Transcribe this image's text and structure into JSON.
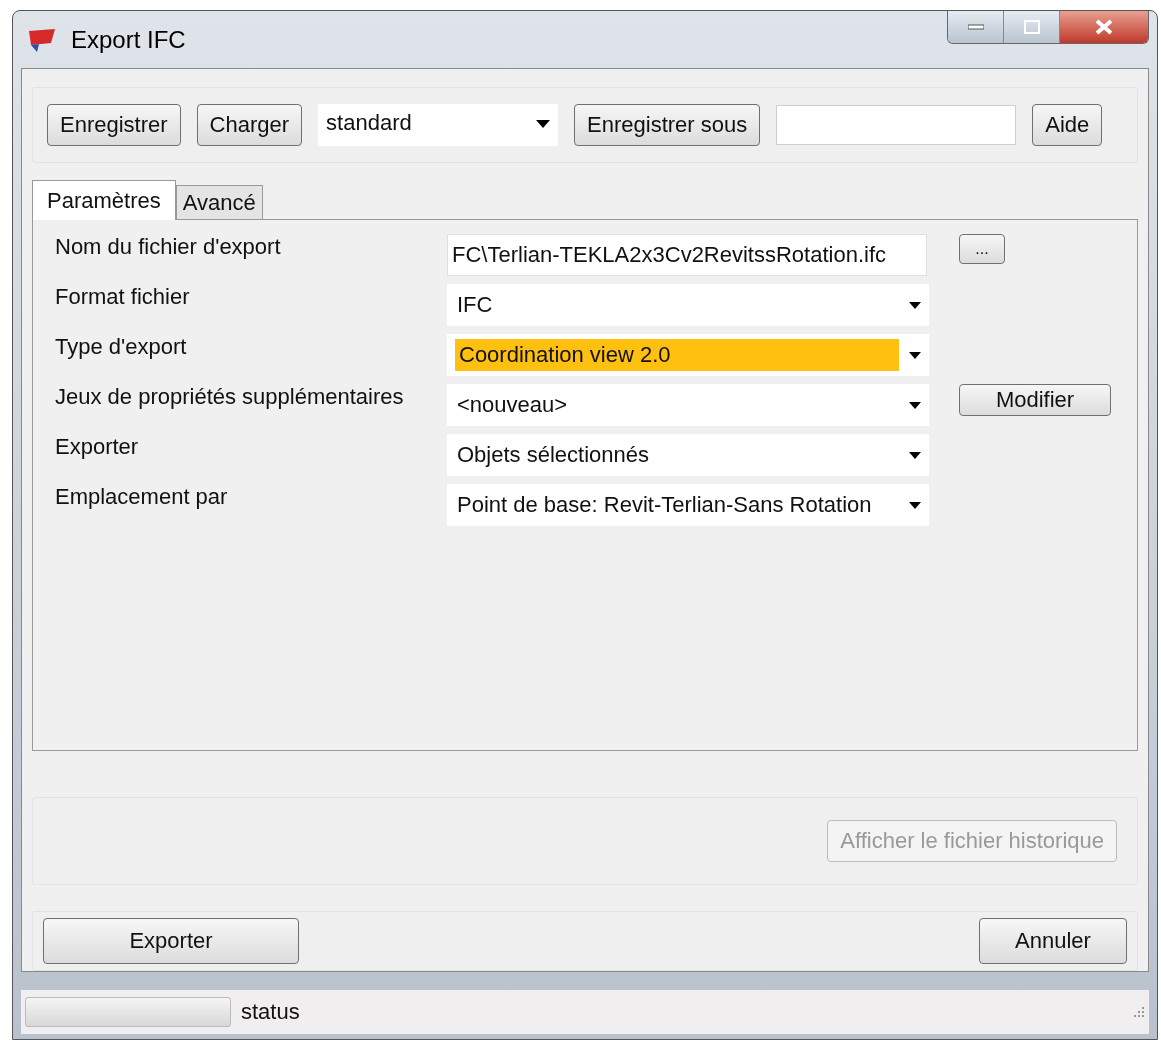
{
  "window": {
    "title": "Export IFC"
  },
  "toolbar": {
    "buttons": [
      "Enregistrer",
      "Charger"
    ],
    "config_select": "standard",
    "save_as_button": "Enregistrer sous",
    "help_button": "Aide"
  },
  "tabs": [
    {
      "label": "Paramètres",
      "selected": true
    },
    {
      "label": "Avancé",
      "selected": false
    }
  ],
  "fields": [
    {
      "label": "Nom du fichier d'export",
      "kind": "text",
      "value": "FC\\Terlian-TEKLA2x3Cv2RevitssRotation.ifc",
      "button": "..."
    },
    {
      "label": "Format fichier",
      "kind": "dropdown",
      "value": "IFC"
    },
    {
      "label": "Type d'export",
      "kind": "dropdown",
      "value": "Coordination view 2.0",
      "highlighted": true
    },
    {
      "label": "Jeux de propriétés supplémentaires",
      "kind": "dropdown",
      "value": "<nouveau>",
      "button": "Modifier"
    },
    {
      "label": "Exporter",
      "kind": "dropdown",
      "value": "Objets sélectionnés"
    },
    {
      "label": "Emplacement par",
      "kind": "dropdown",
      "value": "Point de base: Revit-Terlian-Sans Rotation"
    }
  ],
  "log_button": {
    "label": "Afficher le fichier historique",
    "disabled": true
  },
  "footer": {
    "export_button": "Exporter",
    "cancel_button": "Annuler"
  },
  "status_bar": {
    "progress": {
      "level": 0
    },
    "text": "status"
  }
}
